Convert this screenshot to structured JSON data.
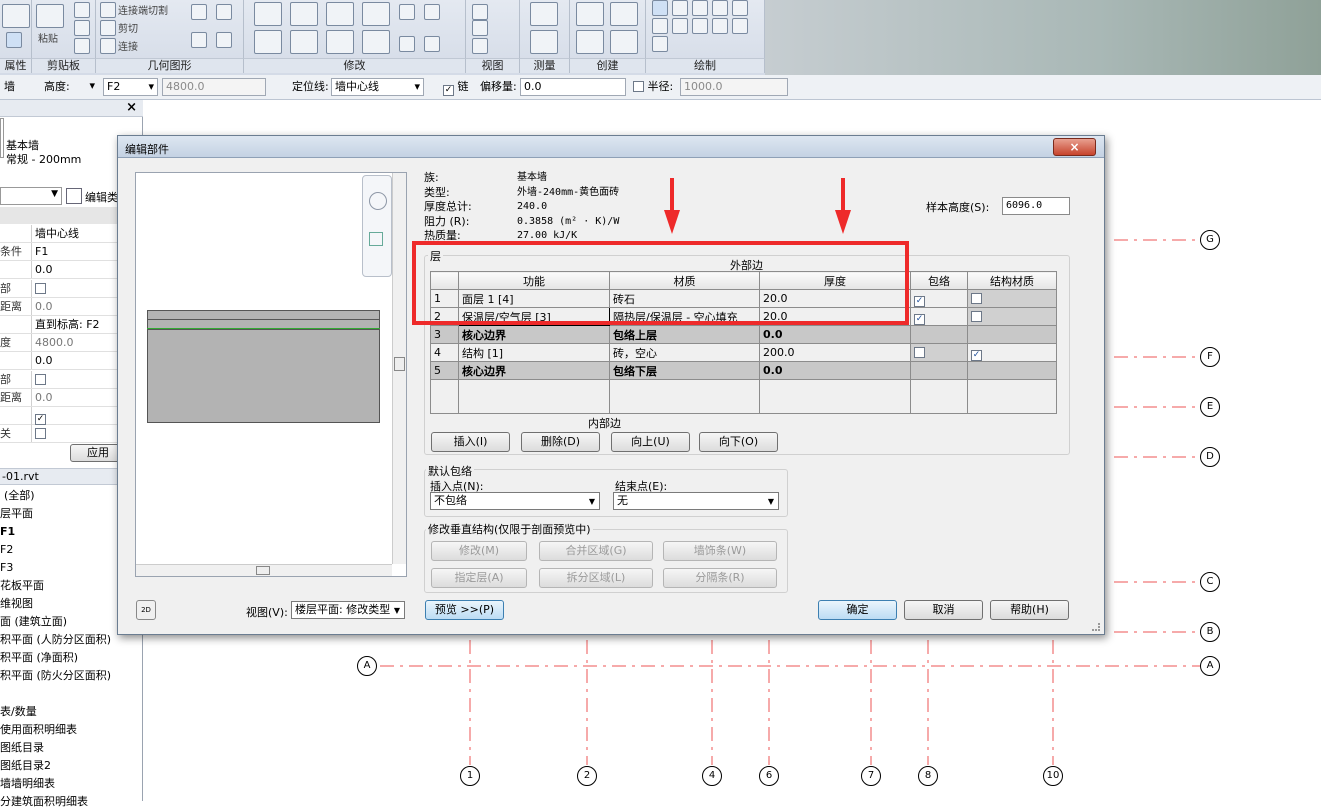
{
  "ribbon": {
    "groups": [
      "属性",
      "剪贴板",
      "几何图形",
      "修改",
      "视图",
      "测量",
      "创建",
      "绘制"
    ],
    "items": {
      "paste": "粘贴",
      "join_cut": "连接端切割",
      "cut": "剪切",
      "join": "连接"
    }
  },
  "options_bar": {
    "category": "墙",
    "height_label": "高度:",
    "level": "F2",
    "height_value": "4800.0",
    "locline_label": "定位线:",
    "locline_value": "墙中心线",
    "chain_label": "链",
    "offset_label": "偏移量:",
    "offset_value": "0.0",
    "radius_label": "半径:",
    "radius_value": "1000.0"
  },
  "properties": {
    "close": "×",
    "type_line1": "基本墙",
    "type_line2": "常规 - 200mm",
    "edit_type": "编辑类",
    "collapse": "»",
    "rows": [
      {
        "key": "",
        "value": "墙中心线"
      },
      {
        "key": "条件",
        "value": "F1"
      },
      {
        "key": "",
        "value": "0.0"
      },
      {
        "key": "部",
        "value": ""
      },
      {
        "key": "距离",
        "value": "0.0"
      },
      {
        "key": "",
        "value": "直到标高: F2"
      },
      {
        "key": "度",
        "value": "4800.0"
      },
      {
        "key": "",
        "value": "0.0"
      },
      {
        "key": "部",
        "value": ""
      },
      {
        "key": "距离",
        "value": "0.0"
      },
      {
        "key": "",
        "value": ""
      },
      {
        "key": "关",
        "value": ""
      }
    ],
    "apply": "应用"
  },
  "browser": {
    "title": "-01.rvt",
    "items": [
      "(全部)",
      "层平面",
      "F1",
      "F2",
      "F3",
      "花板平面",
      "维视图",
      "面 (建筑立面)",
      "积平面 (人防分区面积)",
      "积平面 (净面积)",
      "积平面 (防火分区面积)",
      "",
      "表/数量",
      "使用面积明细表",
      "图纸目录",
      "图纸目录2",
      "墙墙明细表",
      "分建筑面积明细表"
    ]
  },
  "dialog": {
    "title": "编辑部件",
    "close": "×",
    "info": {
      "family_label": "族:",
      "family": "基本墙",
      "type_label": "类型:",
      "type": "外墙-240mm-黄色面砖",
      "thickness_label": "厚度总计:",
      "thickness": "240.0",
      "resistance_label": "阻力 (R):",
      "resistance": "0.3858 (m² · K)/W",
      "mass_label": "热质量:",
      "mass": "27.00 kJ/K"
    },
    "sample_height_label": "样本高度(S):",
    "sample_height": "6096.0",
    "layers_label": "层",
    "exterior": "外部边",
    "interior": "内部边",
    "columns": [
      "功能",
      "材质",
      "厚度",
      "包络",
      "结构材质"
    ],
    "rows": [
      {
        "n": "1",
        "func": "面层 1 [4]",
        "mat": "砖石",
        "thick": "20.0"
      },
      {
        "n": "2",
        "func": "保温层/空气层 [3]",
        "mat": "隔热层/保温层 - 空心填充",
        "thick": "20.0"
      },
      {
        "n": "3",
        "func": "核心边界",
        "mat": "包络上层",
        "thick": "0.0"
      },
      {
        "n": "4",
        "func": "结构 [1]",
        "mat": "砖，空心",
        "thick": "200.0"
      },
      {
        "n": "5",
        "func": "核心边界",
        "mat": "包络下层",
        "thick": "0.0"
      }
    ],
    "layer_buttons": [
      "插入(I)",
      "删除(D)",
      "向上(U)",
      "向下(O)"
    ],
    "wrap_group": "默认包络",
    "insert_point_label": "插入点(N):",
    "insert_point": "不包络",
    "end_point_label": "结束点(E):",
    "end_point": "无",
    "vert_group": "修改垂直结构(仅限于剖面预览中)",
    "vert_buttons": [
      "修改(M)",
      "合并区域(G)",
      "墙饰条(W)",
      "指定层(A)",
      "拆分区域(L)",
      "分隔条(R)"
    ],
    "view_label": "视图(V):",
    "view_value": "楼层平面: 修改类型",
    "preview_btn": "预览 >>(P)",
    "ok": "确定",
    "cancel": "取消",
    "help": "帮助(H)",
    "icon_2d": "2D"
  },
  "grid": {
    "h_labels": [
      "G",
      "F",
      "E",
      "D",
      "C",
      "B",
      "A",
      "A"
    ],
    "v_labels": [
      "1",
      "2",
      "4",
      "6",
      "7",
      "8",
      "10"
    ]
  }
}
